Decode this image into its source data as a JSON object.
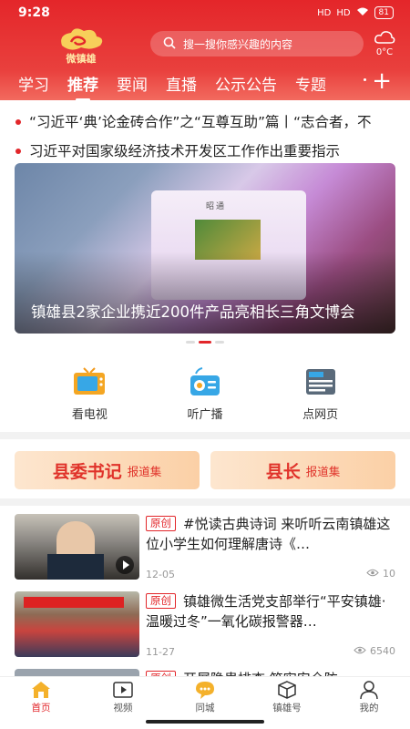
{
  "status_bar": {
    "time": "9:28",
    "signal_1": "HD",
    "signal_2": "HD",
    "battery": "81"
  },
  "header": {
    "logo_text": "微镇雄",
    "search_placeholder": "搜一搜你感兴趣的内容",
    "weather_temp": "0°C",
    "tabs": [
      {
        "label": "学习"
      },
      {
        "label": "推荐"
      },
      {
        "label": "要闻"
      },
      {
        "label": "直播"
      },
      {
        "label": "公示公告"
      },
      {
        "label": "专题"
      }
    ],
    "active_tab": "推荐",
    "accent_color": "#e4262a"
  },
  "headlines": [
    "“习近平‘典’论金砖合作”之“互尊互助”篇丨“志合者，不",
    "习近平对国家级经济技术开发区工作作出重要指示"
  ],
  "banner": {
    "brand": "昭通",
    "caption": "镇雄县2家企业携近200件产品亮相长三角文博会",
    "slide_index": 2
  },
  "quick_entries": [
    {
      "label": "看电视",
      "icon": "tv-icon"
    },
    {
      "label": "听广播",
      "icon": "radio-icon"
    },
    {
      "label": "点网页",
      "icon": "news-page-icon"
    }
  ],
  "reports": [
    {
      "title": "县委书记",
      "sub": "报道集"
    },
    {
      "title": "县长",
      "sub": "报道集"
    }
  ],
  "news": [
    {
      "tag": "原创",
      "title": "#悦读古典诗词 来听听云南镇雄这位小学生如何理解唐诗《…",
      "date": "12-05",
      "views": "10"
    },
    {
      "tag": "原创",
      "title": "镇雄微生活党支部举行“平安镇雄·温暖过冬”一氧化碳报警器…",
      "date": "11-27",
      "views": "6540"
    },
    {
      "tag": "原创",
      "title": "开展隐患排查 筑牢安全防",
      "date": "",
      "views": ""
    }
  ],
  "bottom_nav": [
    {
      "label": "首页",
      "icon": "home-icon"
    },
    {
      "label": "视频",
      "icon": "video-icon"
    },
    {
      "label": "同城",
      "icon": "chat-icon"
    },
    {
      "label": "镇雄号",
      "icon": "cube-icon"
    },
    {
      "label": "我的",
      "icon": "user-icon"
    }
  ]
}
